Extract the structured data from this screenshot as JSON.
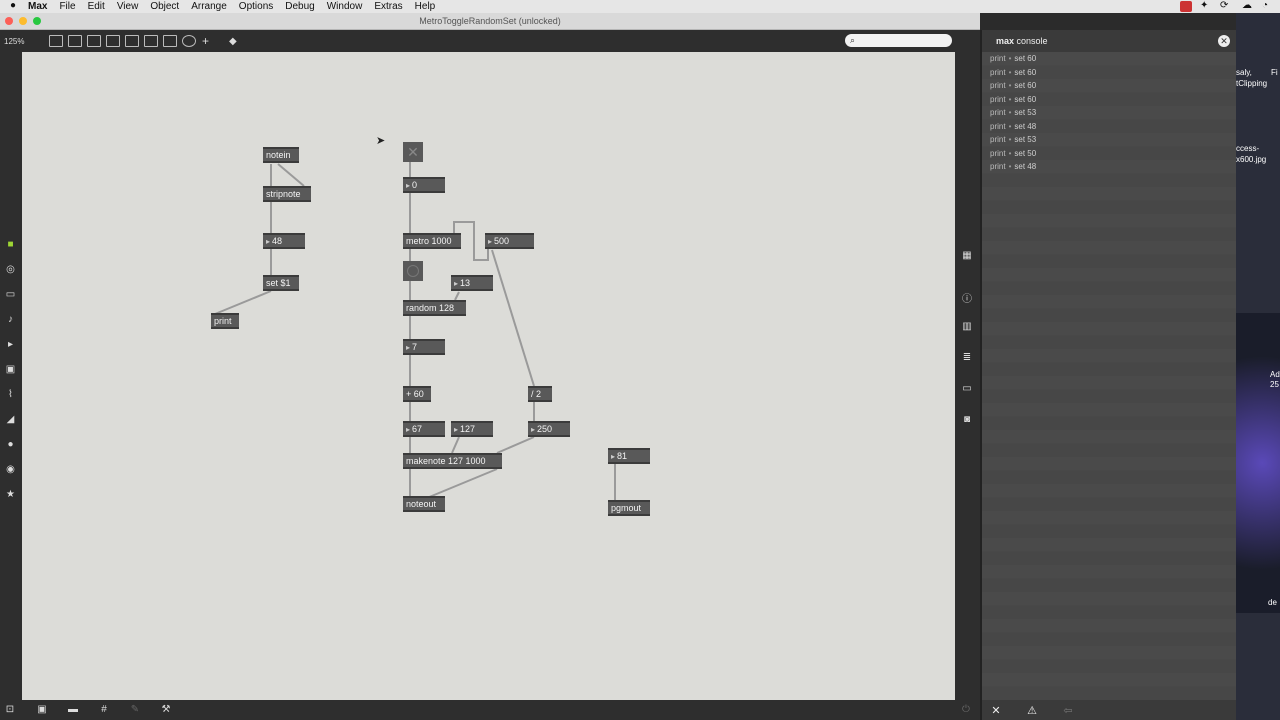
{
  "menubar": {
    "brand": "Max",
    "items": [
      "File",
      "Edit",
      "View",
      "Object",
      "Arrange",
      "Options",
      "Debug",
      "Window",
      "Extras",
      "Help"
    ]
  },
  "window": {
    "title": "MetroToggleRandomSet (unlocked)"
  },
  "toolbar": {
    "zoom": "125%"
  },
  "patch": {
    "objects": {
      "notein": "notein",
      "stripnote": "stripnote",
      "num48": "48",
      "set1": "set $1",
      "print": "print",
      "num0": "0",
      "metro": "metro 1000",
      "num500": "500",
      "num13": "13",
      "random": "random 128",
      "num7": "7",
      "plus60": "+ 60",
      "div2": "/ 2",
      "num67": "67",
      "num127": "127",
      "num250": "250",
      "makenote": "makenote 127 1000",
      "noteout": "noteout",
      "num81": "81",
      "pgmout": "pgmout"
    }
  },
  "console": {
    "title_bold": "max",
    "title_rest": " console",
    "logs": [
      {
        "src": "print",
        "msg": "set 60"
      },
      {
        "src": "print",
        "msg": "set 60"
      },
      {
        "src": "print",
        "msg": "set 60"
      },
      {
        "src": "print",
        "msg": "set 60"
      },
      {
        "src": "print",
        "msg": "set 53"
      },
      {
        "src": "print",
        "msg": "set 48"
      },
      {
        "src": "print",
        "msg": "set 53"
      },
      {
        "src": "print",
        "msg": "set 50"
      },
      {
        "src": "print",
        "msg": "set 48"
      }
    ]
  },
  "desktop": {
    "labels": [
      "saly,",
      "Fi",
      "tClipping",
      "ccess-",
      "x600.jpg",
      "Ad",
      "25",
      "de"
    ]
  },
  "colors": {
    "canvas": "#dcdcd8",
    "object": "#595959",
    "console_bg": "#474747"
  }
}
